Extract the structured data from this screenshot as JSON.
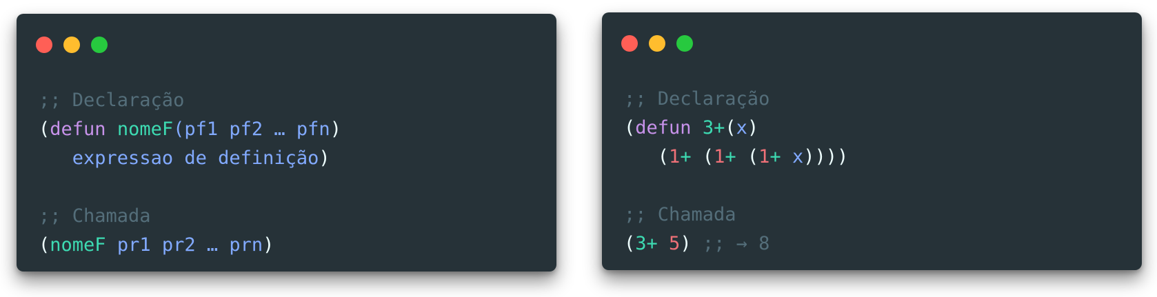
{
  "colors": {
    "background": "#263238",
    "comment": "#546e7a",
    "keyword": "#c792ea",
    "function": "#3ddbb2",
    "variable": "#82aaff",
    "number": "#f07178",
    "paren": "#eeffff"
  },
  "left_card": {
    "comment_declaration": ";; Declaração",
    "open_paren": "(",
    "defun": "defun",
    "fn_name": "nomeF",
    "params_open": "(",
    "params": "pf1 pf2 … pfn",
    "params_close": ")",
    "indent": "   ",
    "body": "expressao de definição",
    "body_close": ")",
    "comment_call": ";; Chamada",
    "call_open": "(",
    "call_fn": "nomeF",
    "call_args": "pr1 pr2 … prn",
    "call_close": ")"
  },
  "right_card": {
    "comment_declaration": ";; Declaração",
    "open_paren": "(",
    "defun": "defun",
    "fn_name": "3+",
    "params_open": "(",
    "param": "x",
    "params_close": ")",
    "indent": "   ",
    "p1": "(",
    "one_a": "1",
    "plus_a": "+",
    "p2": " (",
    "one_b": "1",
    "plus_b": "+",
    "p3": " (",
    "one_c": "1",
    "plus_c": "+",
    "space": " ",
    "x": "x",
    "close": "))))",
    "comment_call": ";; Chamada",
    "call_open": "(",
    "call_fn": "3+",
    "call_arg": "5",
    "call_close": ")",
    "result_comment": ";; → 8"
  }
}
